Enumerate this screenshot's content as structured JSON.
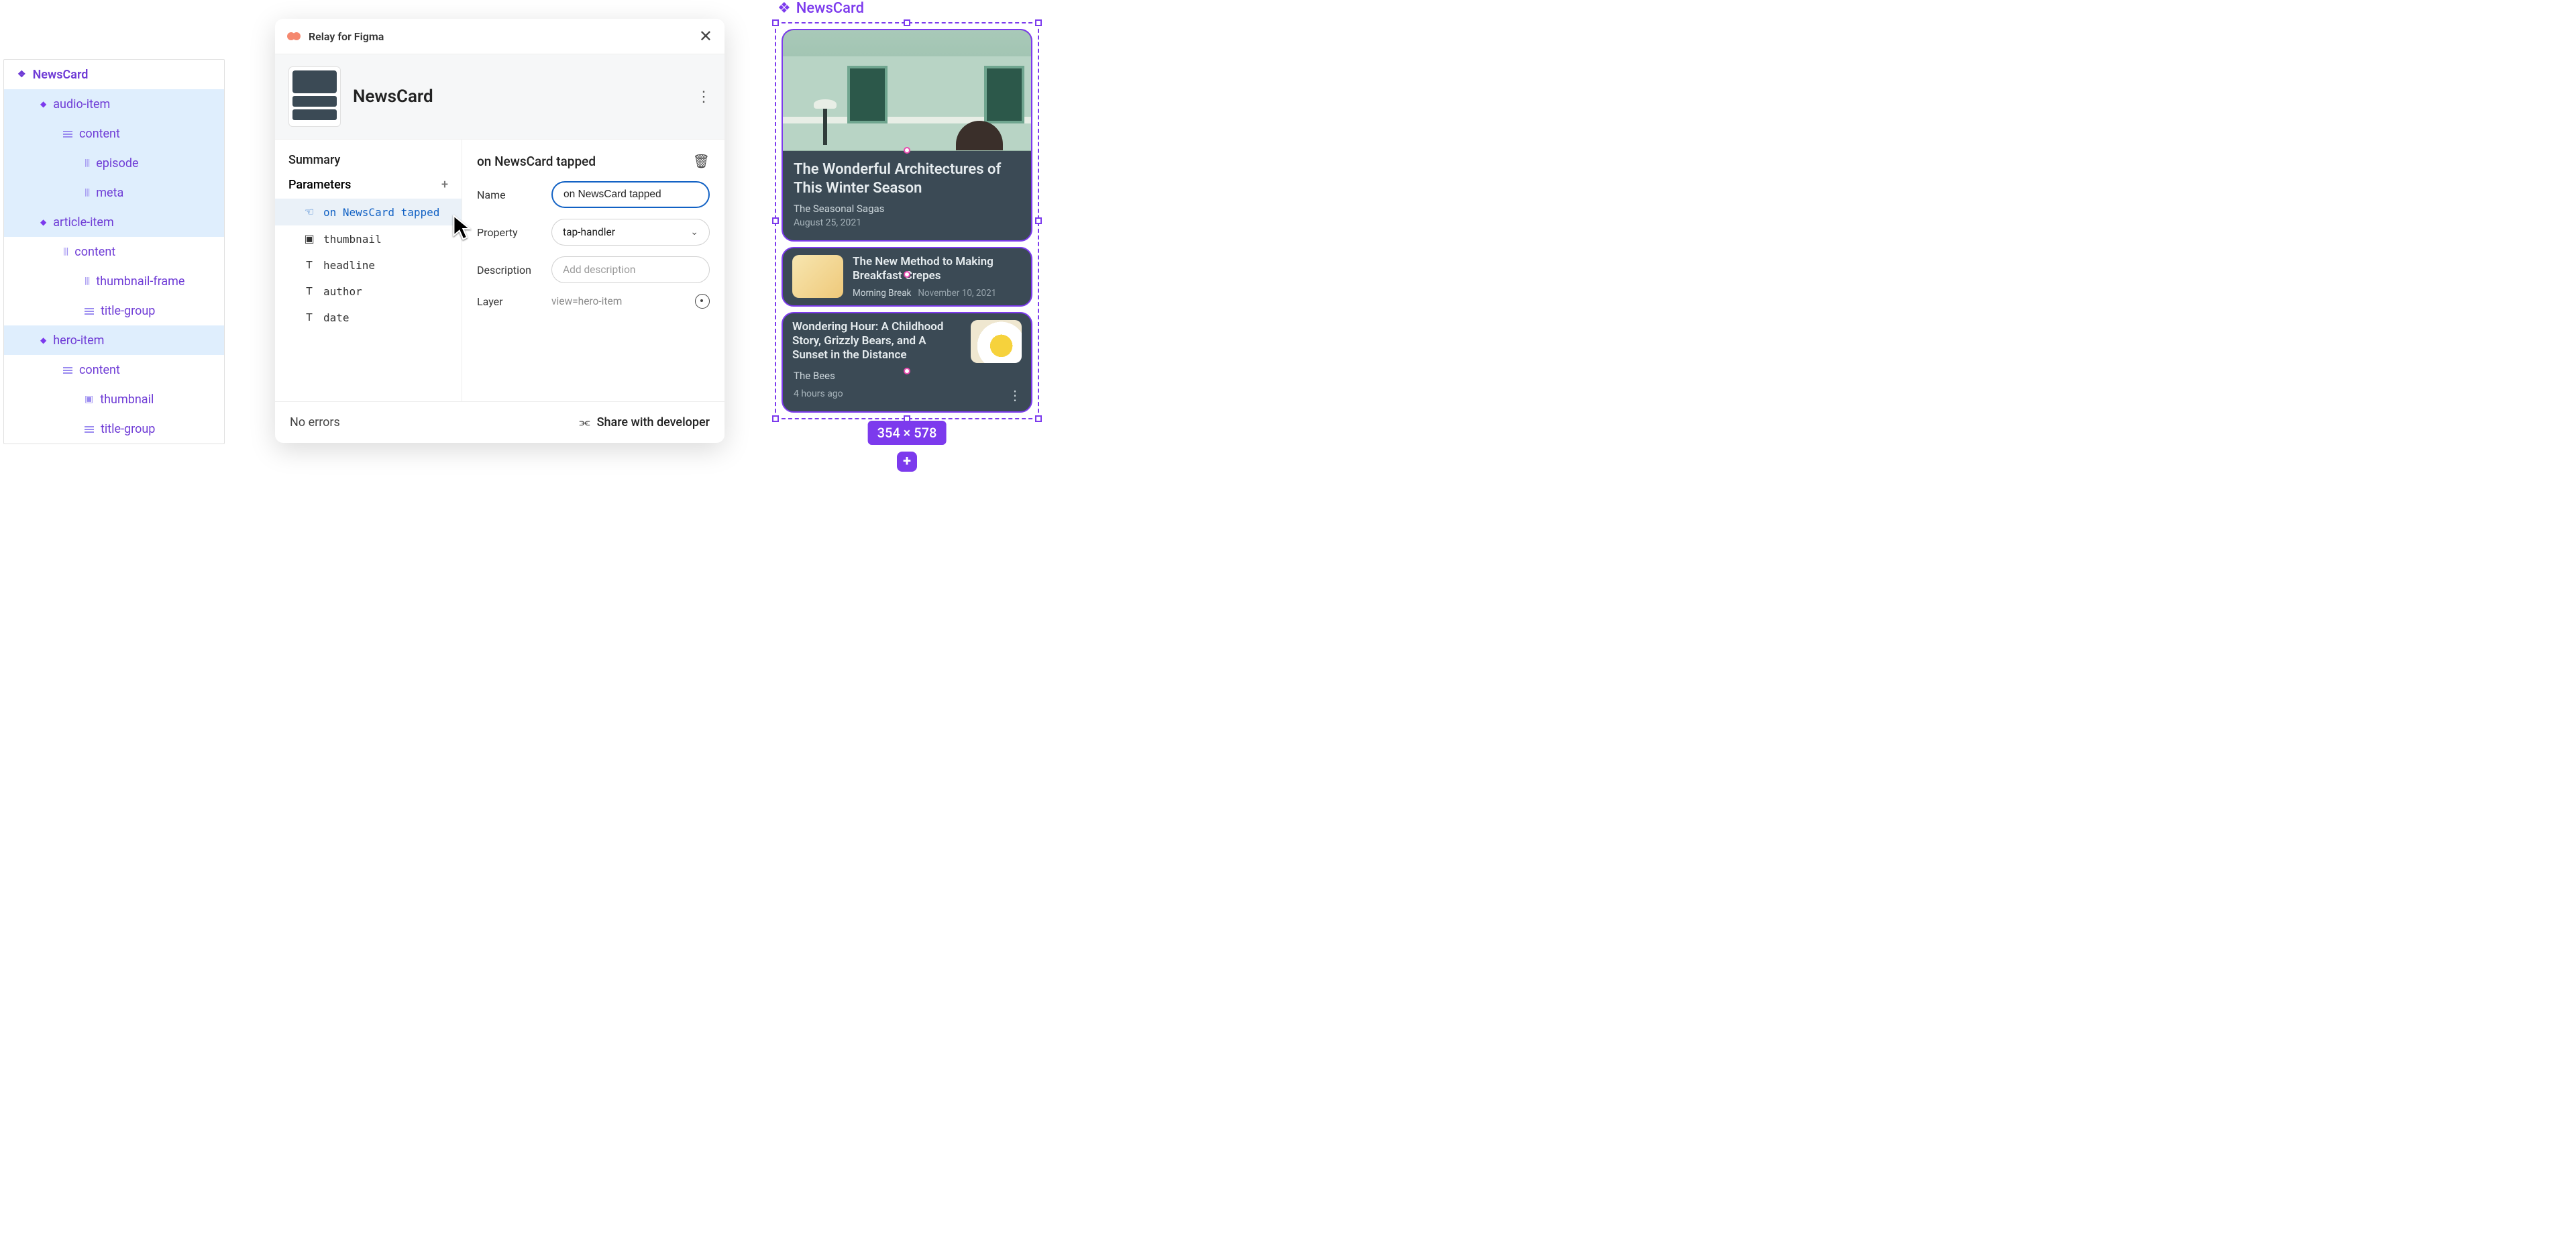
{
  "layers": {
    "root": "NewsCard",
    "items": [
      {
        "label": "audio-item",
        "icon": "diamond",
        "lvl": 1,
        "selected": true
      },
      {
        "label": "content",
        "icon": "lines",
        "lvl": 2,
        "selected": true
      },
      {
        "label": "episode",
        "icon": "cols",
        "lvl": 3,
        "selected": true
      },
      {
        "label": "meta",
        "icon": "cols",
        "lvl": 3,
        "selected": true
      },
      {
        "label": "article-item",
        "icon": "diamond",
        "lvl": 1,
        "selected": true
      },
      {
        "label": "content",
        "icon": "cols",
        "lvl": 2,
        "selected": false
      },
      {
        "label": "thumbnail-frame",
        "icon": "cols",
        "lvl": 3,
        "selected": false
      },
      {
        "label": "title-group",
        "icon": "lines",
        "lvl": 3,
        "selected": false
      },
      {
        "label": "hero-item",
        "icon": "diamond",
        "lvl": 1,
        "selected": true
      },
      {
        "label": "content",
        "icon": "lines",
        "lvl": 2,
        "selected": false
      },
      {
        "label": "thumbnail",
        "icon": "image",
        "lvl": 3,
        "selected": false
      },
      {
        "label": "title-group",
        "icon": "lines",
        "lvl": 3,
        "selected": false
      }
    ]
  },
  "plugin": {
    "name": "Relay for Figma",
    "component": "NewsCard",
    "summary_label": "Summary",
    "parameters_label": "Parameters",
    "params": [
      {
        "label": "on NewsCard tapped",
        "icon": "tap",
        "selected": true
      },
      {
        "label": "thumbnail",
        "icon": "image",
        "selected": false
      },
      {
        "label": "headline",
        "icon": "text",
        "selected": false
      },
      {
        "label": "author",
        "icon": "text",
        "selected": false
      },
      {
        "label": "date",
        "icon": "text",
        "selected": false
      }
    ],
    "detail": {
      "title": "on NewsCard tapped",
      "name_label": "Name",
      "name_value": "on NewsCard tapped",
      "property_label": "Property",
      "property_value": "tap-handler",
      "description_label": "Description",
      "description_placeholder": "Add description",
      "layer_label": "Layer",
      "layer_value": "view=hero-item"
    },
    "footer": {
      "status": "No errors",
      "share": "Share with developer"
    }
  },
  "canvas": {
    "label": "NewsCard",
    "dimensions": "354 × 578",
    "hero": {
      "title": "The Wonderful Architectures of This Winter Season",
      "publisher": "The Seasonal Sagas",
      "date": "August 25, 2021"
    },
    "article": {
      "title": "The New Method to Making Breakfast Crepes",
      "publisher": "Morning Break",
      "date": "November 10, 2021"
    },
    "audio": {
      "title": "Wondering Hour: A Childhood Story, Grizzly Bears, and A Sunset in the Distance",
      "publisher": "The Bees",
      "date": "4 hours ago"
    }
  }
}
